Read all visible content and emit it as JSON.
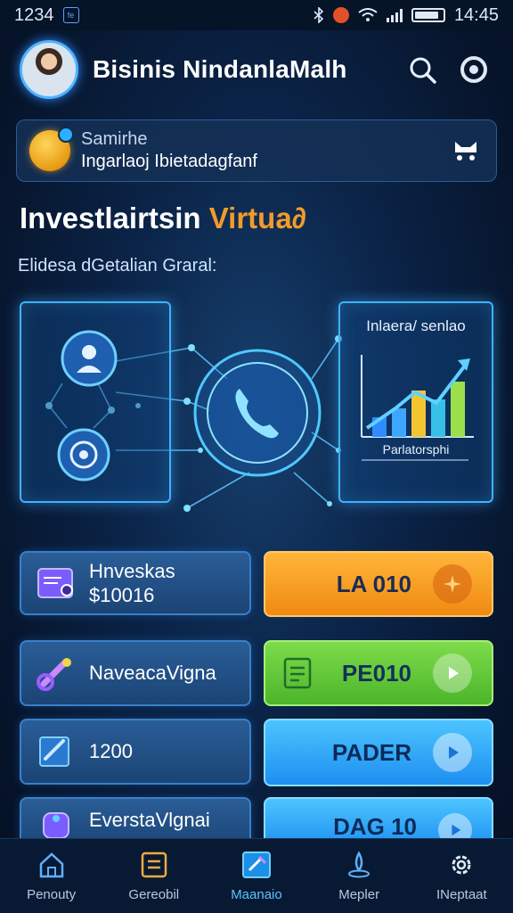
{
  "status_bar": {
    "time_left": "1234",
    "time_right": "14:45",
    "badge_icon": "app-badge-icon"
  },
  "header": {
    "title": "Bisinis NindanlaMalh",
    "avatar_icon": "avatar-icon",
    "search_icon": "search-icon",
    "settings_icon": "target-icon"
  },
  "notice": {
    "title": "Samirhe",
    "subtitle": "Ingarlaoj Ibietadagfanf",
    "action_icon": "share-icon"
  },
  "headline": {
    "main": "Investlairtsin ",
    "accent": "Virtua∂",
    "accent_color": "#f39a2a"
  },
  "subheadline": "Elidesa dGetalian Graral:",
  "illustration": {
    "panel_right_title": "Inlaera/ senlao",
    "panel_right_caption": "Parlatorsphi"
  },
  "rows": [
    {
      "card_line1": "Hnveskas",
      "card_line2": "$10016",
      "card_icon": "wallet-icon",
      "button_label": "LA 010",
      "button_icon": "star-icon",
      "button_color": "orange"
    },
    {
      "card_line1": "NaveacaVigna",
      "card_line2": "",
      "card_icon": "link-icon",
      "button_label": "PE010",
      "button_icon": "play-icon",
      "button_color": "green"
    },
    {
      "card_line1": "1200",
      "card_line2": "",
      "card_icon": "pen-icon",
      "button_label": "PADER",
      "button_icon": "play-icon",
      "button_color": "blue"
    },
    {
      "card_line1": "EverstaVlgnai",
      "card_line2": "",
      "card_icon": "box-icon",
      "button_label": "DAG 10",
      "button_icon": "play-icon",
      "button_color": "blue"
    }
  ],
  "nav": [
    {
      "label": "Penouty",
      "icon": "home-icon",
      "active": false
    },
    {
      "label": "Gereobil",
      "icon": "list-icon",
      "active": false
    },
    {
      "label": "Maanaio",
      "icon": "tools-icon",
      "active": true
    },
    {
      "label": "Mepler",
      "icon": "pin-icon",
      "active": false
    },
    {
      "label": "INeptaat",
      "icon": "gear-icon",
      "active": false
    }
  ]
}
